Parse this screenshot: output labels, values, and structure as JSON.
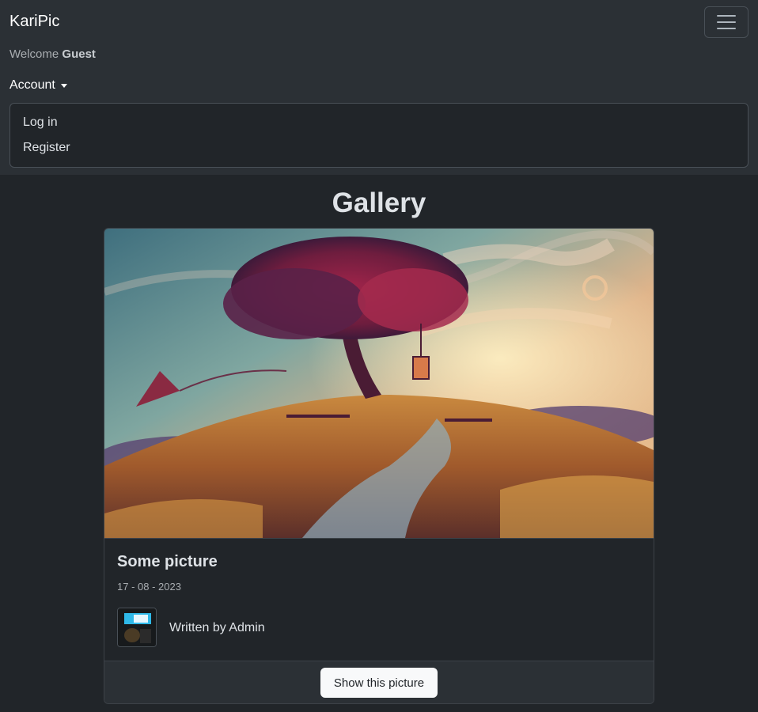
{
  "navbar": {
    "brand": "KariPic",
    "welcome_prefix": "Welcome ",
    "welcome_user": "Guest",
    "account_label": "Account",
    "dropdown_items": [
      {
        "label": "Log in"
      },
      {
        "label": "Register"
      }
    ]
  },
  "main": {
    "title": "Gallery",
    "card": {
      "title": "Some picture",
      "date": "17 - 08 - 2023",
      "author_text": "Written by Admin",
      "button_label": "Show this picture"
    }
  },
  "icons": {
    "menu": "hamburger-icon",
    "caret": "caret-down-icon"
  },
  "colors": {
    "navbar_bg": "#2b3035",
    "page_bg": "#212529",
    "button_bg": "#f8f9fa"
  }
}
